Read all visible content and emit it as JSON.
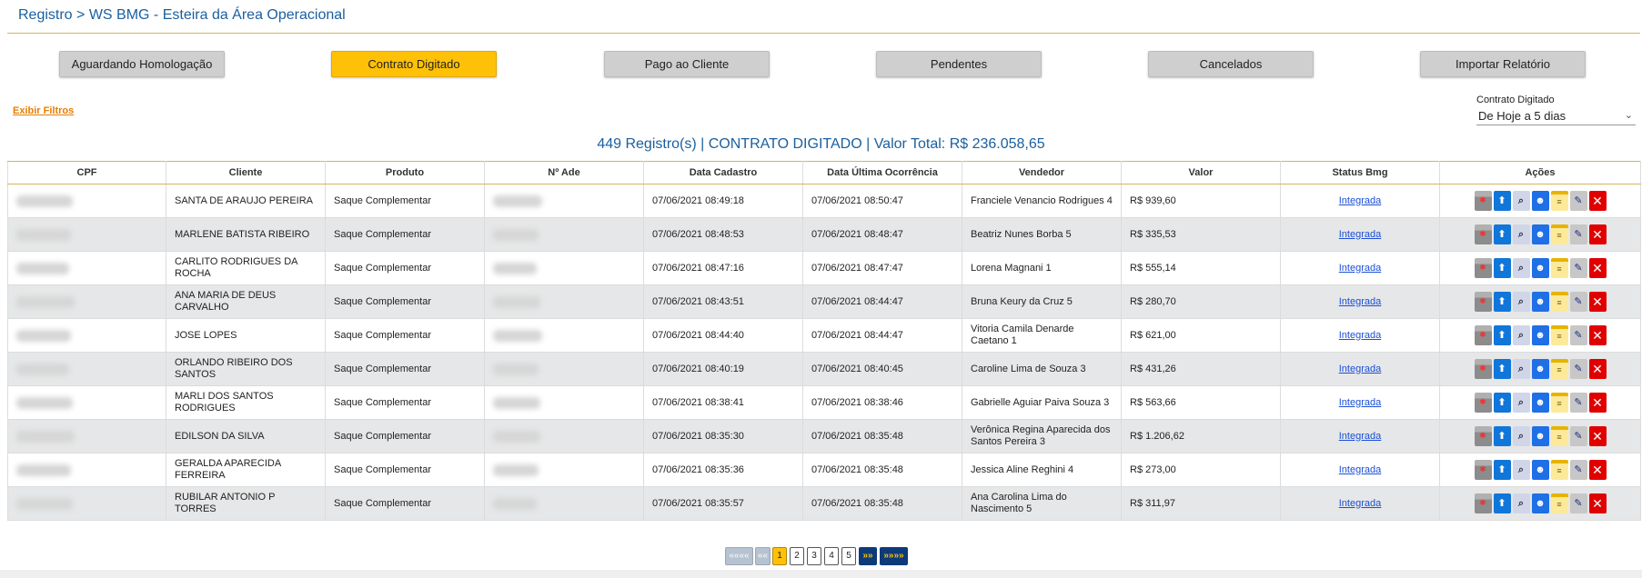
{
  "breadcrumb": "Registro > WS BMG - Esteira da Área Operacional",
  "tabs": [
    {
      "label": "Aguardando Homologação",
      "active": false
    },
    {
      "label": "Contrato Digitado",
      "active": true
    },
    {
      "label": "Pago ao Cliente",
      "active": false
    },
    {
      "label": "Pendentes",
      "active": false
    },
    {
      "label": "Cancelados",
      "active": false
    },
    {
      "label": "Importar Relatório",
      "active": false
    }
  ],
  "filters_link": "Exibir Filtros",
  "date_filter": {
    "label": "Contrato Digitado",
    "selected": "De Hoje a 5 dias"
  },
  "summary": "449 Registro(s) | CONTRATO DIGITADO | Valor Total: R$ 236.058,65",
  "columns": [
    "CPF",
    "Cliente",
    "Produto",
    "Nº Ade",
    "Data Cadastro",
    "Data Última Ocorrência",
    "Vendedor",
    "Valor",
    "Status Bmg",
    "Ações"
  ],
  "rows": [
    {
      "cliente": "SANTA DE ARAUJO PEREIRA",
      "produto": "Saque Complementar",
      "cadastro": "07/06/2021 08:49:18",
      "ocorrencia": "07/06/2021 08:50:47",
      "vendedor": "Franciele Venancio Rodrigues 4",
      "valor": "R$ 939,60",
      "status": "Integrada"
    },
    {
      "cliente": "MARLENE BATISTA RIBEIRO",
      "produto": "Saque Complementar",
      "cadastro": "07/06/2021 08:48:53",
      "ocorrencia": "07/06/2021 08:48:47",
      "vendedor": "Beatriz Nunes Borba 5",
      "valor": "R$ 335,53",
      "status": "Integrada"
    },
    {
      "cliente": "CARLITO RODRIGUES DA ROCHA",
      "produto": "Saque Complementar",
      "cadastro": "07/06/2021 08:47:16",
      "ocorrencia": "07/06/2021 08:47:47",
      "vendedor": "Lorena Magnani 1",
      "valor": "R$ 555,14",
      "status": "Integrada"
    },
    {
      "cliente": "ANA MARIA DE DEUS CARVALHO",
      "produto": "Saque Complementar",
      "cadastro": "07/06/2021 08:43:51",
      "ocorrencia": "07/06/2021 08:44:47",
      "vendedor": "Bruna Keury da Cruz 5",
      "valor": "R$ 280,70",
      "status": "Integrada"
    },
    {
      "cliente": "JOSE LOPES",
      "produto": "Saque Complementar",
      "cadastro": "07/06/2021 08:44:40",
      "ocorrencia": "07/06/2021 08:44:47",
      "vendedor": "Vitoria Camila Denarde Caetano 1",
      "valor": "R$ 621,00",
      "status": "Integrada"
    },
    {
      "cliente": "ORLANDO RIBEIRO DOS SANTOS",
      "produto": "Saque Complementar",
      "cadastro": "07/06/2021 08:40:19",
      "ocorrencia": "07/06/2021 08:40:45",
      "vendedor": "Caroline Lima de Souza 3",
      "valor": "R$ 431,26",
      "status": "Integrada"
    },
    {
      "cliente": "MARLI DOS SANTOS RODRIGUES",
      "produto": "Saque Complementar",
      "cadastro": "07/06/2021 08:38:41",
      "ocorrencia": "07/06/2021 08:38:46",
      "vendedor": "Gabrielle Aguiar Paiva Souza 3",
      "valor": "R$ 563,66",
      "status": "Integrada"
    },
    {
      "cliente": "EDILSON DA SILVA",
      "produto": "Saque Complementar",
      "cadastro": "07/06/2021 08:35:30",
      "ocorrencia": "07/06/2021 08:35:48",
      "vendedor": "Verônica Regina Aparecida dos Santos Pereira 3",
      "valor": "R$ 1.206,62",
      "status": "Integrada"
    },
    {
      "cliente": "GERALDA APARECIDA FERREIRA",
      "produto": "Saque Complementar",
      "cadastro": "07/06/2021 08:35:36",
      "ocorrencia": "07/06/2021 08:35:48",
      "vendedor": "Jessica Aline Reghini 4",
      "valor": "R$ 273,00",
      "status": "Integrada"
    },
    {
      "cliente": "RUBILAR ANTONIO P TORRES",
      "produto": "Saque Complementar",
      "cadastro": "07/06/2021 08:35:57",
      "ocorrencia": "07/06/2021 08:35:48",
      "vendedor": "Ana Carolina Lima do Nascimento 5",
      "valor": "R$ 311,97",
      "status": "Integrada"
    }
  ],
  "row_actions": [
    "calendar-icon",
    "upload-icon",
    "zoom-icon",
    "user-icon",
    "note-icon",
    "edit-icon",
    "delete-icon"
  ],
  "pagination": {
    "first": "««««",
    "prev": "««",
    "pages": [
      "1",
      "2",
      "3",
      "4",
      "5"
    ],
    "current": "1",
    "next": "»»",
    "last": "»»»»"
  },
  "colors": {
    "accent": "#ffc107",
    "link": "#1a5f9e",
    "rule": "#d7b45a",
    "pager_nav": "#0d3b7a"
  }
}
